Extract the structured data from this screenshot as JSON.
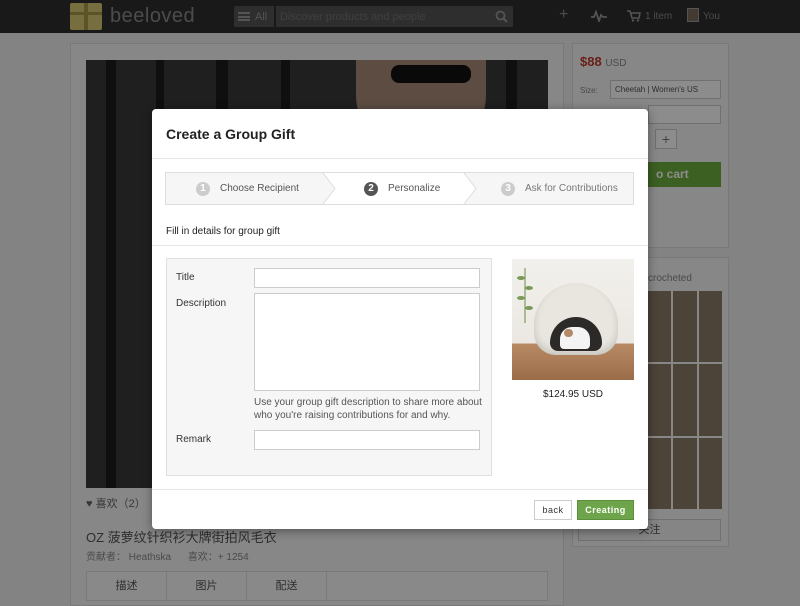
{
  "nav": {
    "logo_text": "beeloved",
    "all_label": "All",
    "search_placeholder": "Discover products and people",
    "cart_label": "1 item",
    "user_label": "You"
  },
  "background": {
    "like_label": "喜欢（2）",
    "product_title": "OZ 菠萝纹针织衫大牌街拍风毛衣",
    "contributor_label": "贡献者：",
    "contributor_name": "Heathska",
    "likes_label": "喜欢：+ 1254",
    "tabs": [
      "描述",
      "图片",
      "配送"
    ],
    "price_value": "$88",
    "price_currency": "USD",
    "size_label": "Size:",
    "size_value": "Cheetah | Women's US",
    "cart_button": "o cart",
    "crocheted_label": "crocheted",
    "follow_label": "关注"
  },
  "modal": {
    "title": "Create a Group Gift",
    "steps": [
      {
        "num": "1",
        "label": "Choose Recipient",
        "active": false
      },
      {
        "num": "2",
        "label": "Personalize",
        "active": true
      },
      {
        "num": "3",
        "label": "Ask for Contributions",
        "active": false
      }
    ],
    "fill_label": "Fill in details for group gift",
    "form": {
      "title_label": "Title",
      "title_value": "",
      "description_label": "Description",
      "description_value": "",
      "help_text": "Use your group gift description to share more about who you're raising contributions for and why.",
      "remark_label": "Remark",
      "remark_value": ""
    },
    "product_price": "$124.95 USD",
    "back_button": "back",
    "create_button": "Creating"
  },
  "colors": {
    "accent_green": "#6ea54a",
    "nav_bg": "#2f2f2f",
    "price_red": "#c0392b"
  }
}
